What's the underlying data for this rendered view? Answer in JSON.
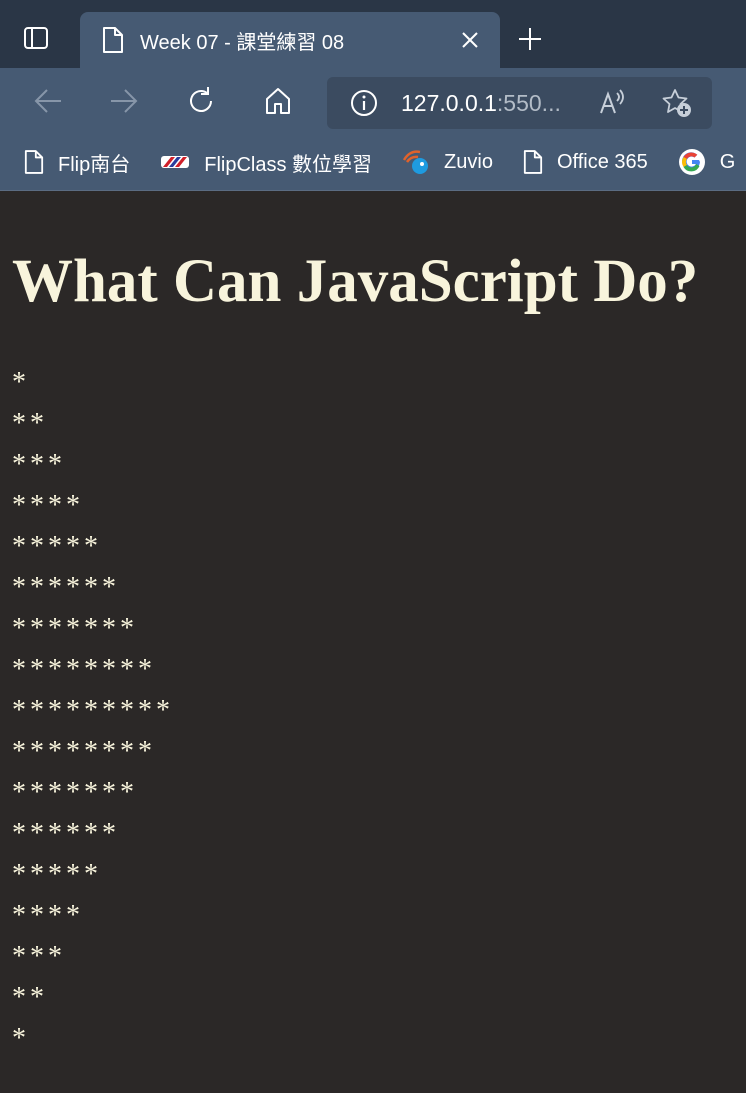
{
  "browser": {
    "tab": {
      "title": "Week 07 - 課堂練習 08"
    },
    "address": {
      "host": "127.0.0.1",
      "rest": ":550..."
    },
    "bookmarks": [
      {
        "label": "Flip南台",
        "icon": "page-icon"
      },
      {
        "label": "FlipClass 數位學習",
        "icon": "flipclass-logo-icon"
      },
      {
        "label": "Zuvio",
        "icon": "zuvio-logo-icon"
      },
      {
        "label": "Office 365",
        "icon": "page-icon"
      },
      {
        "label": "G",
        "icon": "google-logo-icon"
      }
    ]
  },
  "page": {
    "heading": "What Can JavaScript Do?",
    "lines": [
      "*",
      "**",
      "***",
      "****",
      "*****",
      "******",
      "*******",
      "********",
      "*********",
      "********",
      "*******",
      "******",
      "*****",
      "****",
      "***",
      "**",
      "*"
    ]
  },
  "colors": {
    "tabbar": "#2a3646",
    "toolbar": "#465a73",
    "page_bg": "#2b2827",
    "text": "#f8f4dc"
  }
}
